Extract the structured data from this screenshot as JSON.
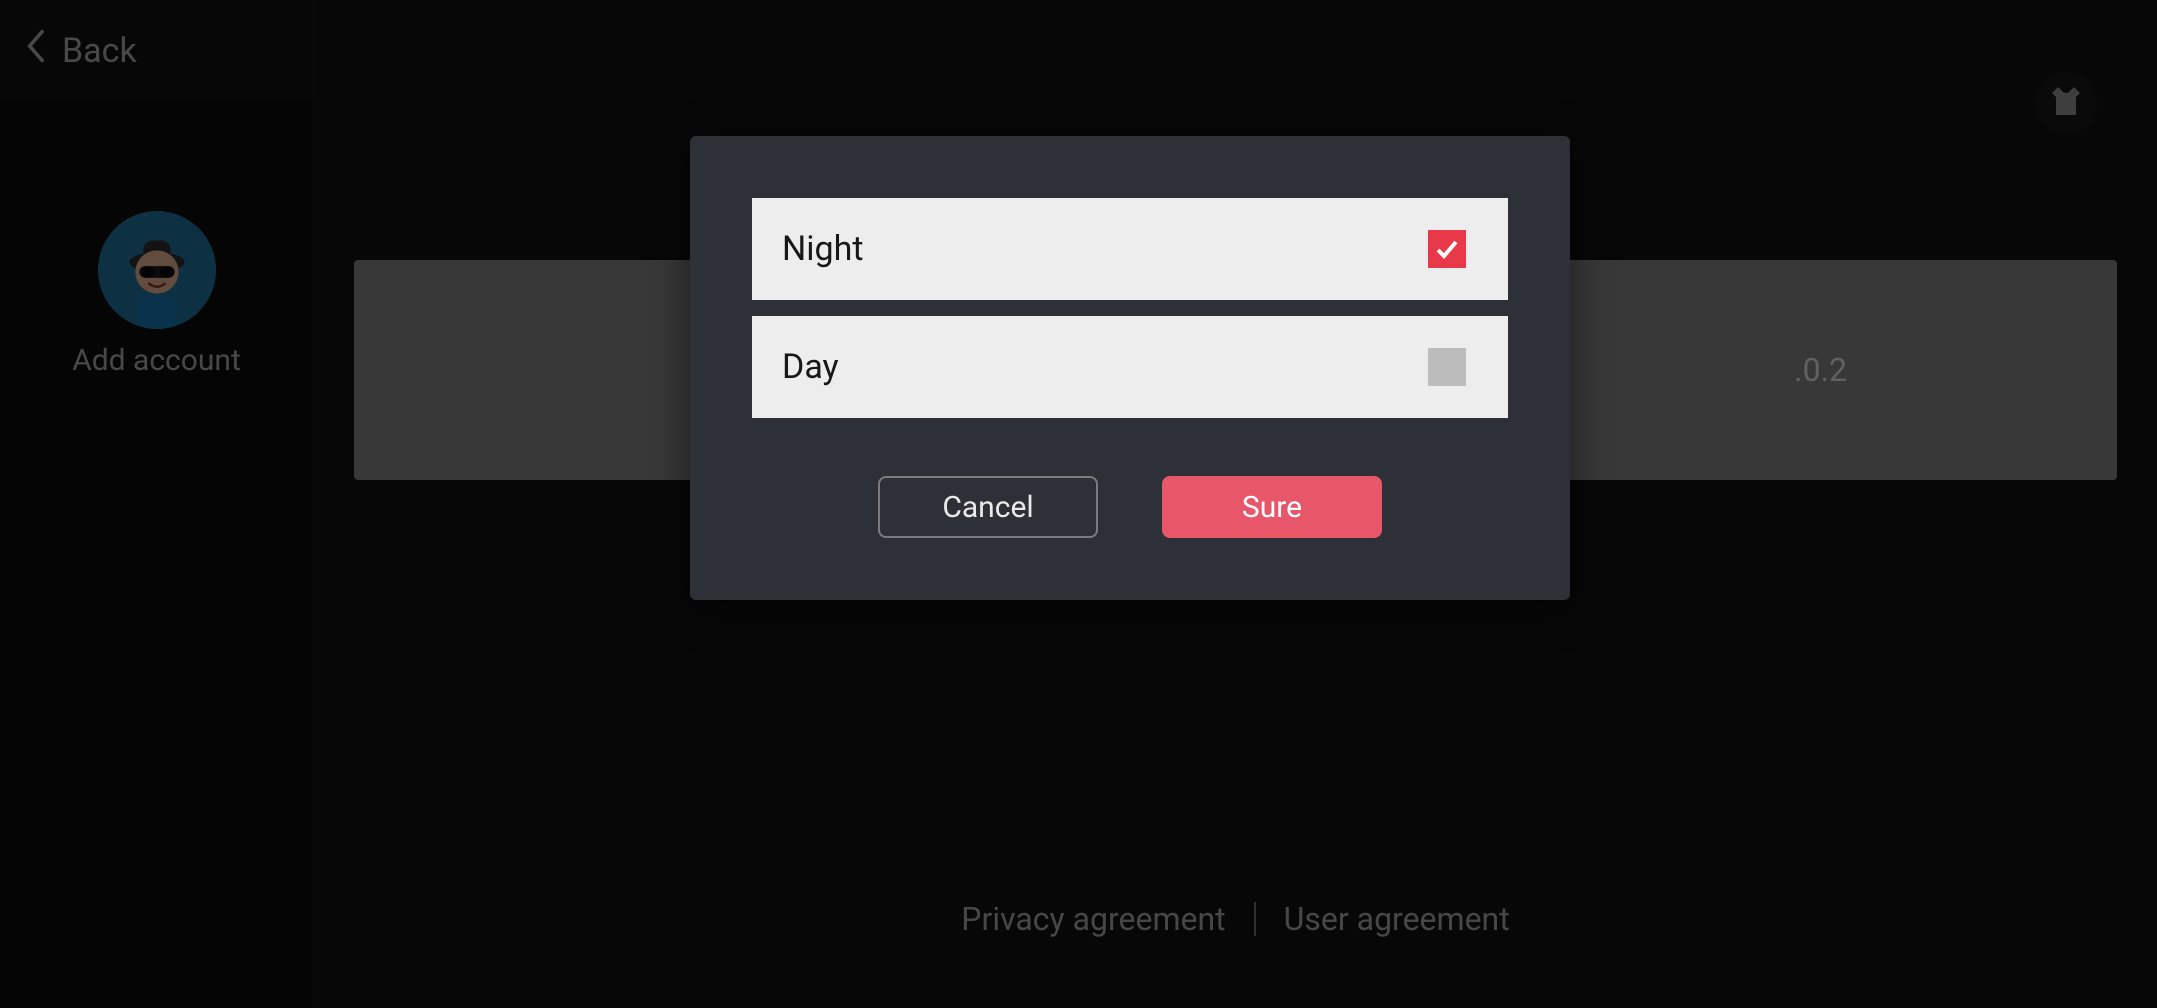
{
  "sidebar": {
    "back_label": "Back",
    "add_account_label": "Add account"
  },
  "main": {
    "version_text": ".0.2"
  },
  "footer": {
    "privacy_label": "Privacy agreement",
    "user_label": "User agreement"
  },
  "dialog": {
    "options": [
      {
        "label": "Night",
        "checked": true
      },
      {
        "label": "Day",
        "checked": false
      }
    ],
    "cancel_label": "Cancel",
    "confirm_label": "Sure"
  },
  "icons": {
    "back": "chevron-left-icon",
    "theme": "shirt-icon",
    "avatar": "avatar-icon"
  },
  "colors": {
    "accent": "#e8394a",
    "dialog_bg": "#2d3036",
    "option_bg": "#ededed"
  }
}
